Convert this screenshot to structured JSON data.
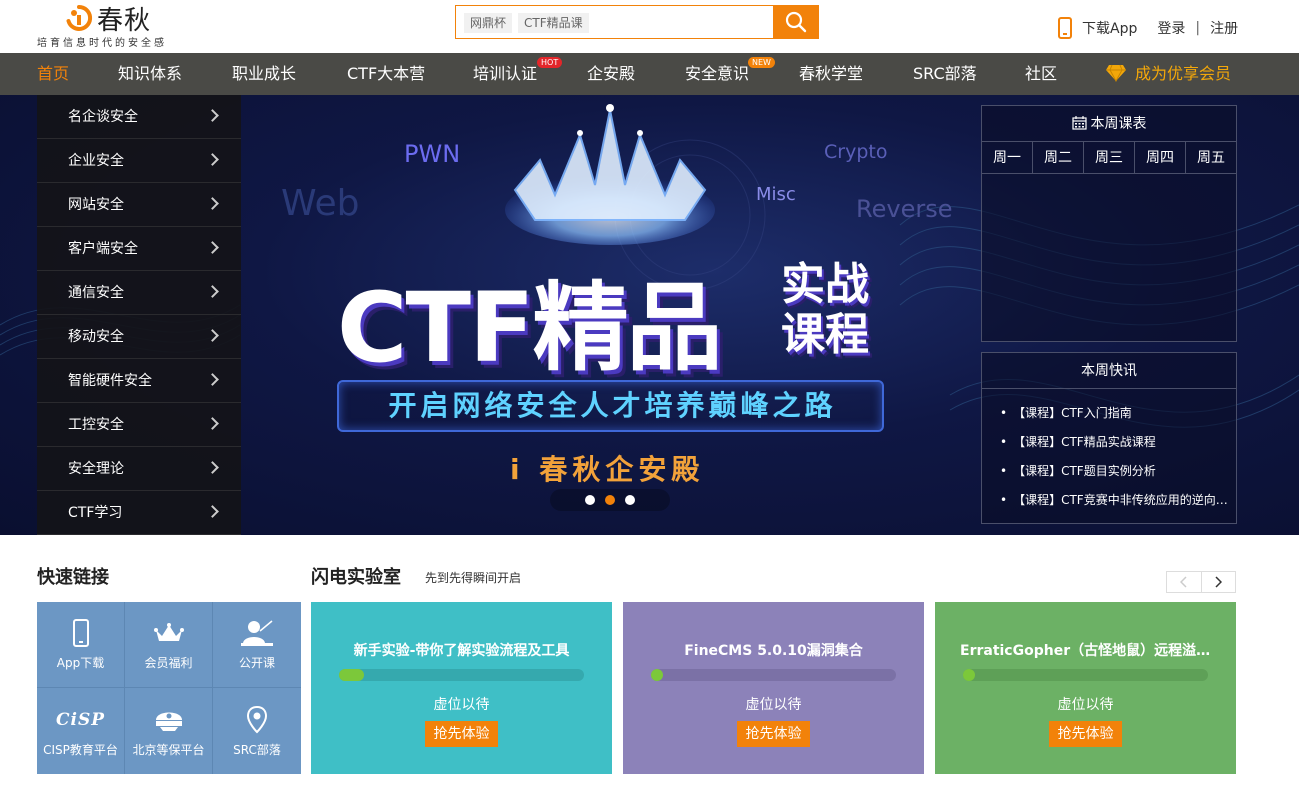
{
  "header": {
    "logo_text": "春秋",
    "slogan": "培育信息时代的安全感",
    "search_tags": [
      "网鼎杯",
      "CTF精品课"
    ],
    "download_app": "下载App",
    "login": "登录",
    "separator": "|",
    "register": "注册"
  },
  "nav": {
    "items": [
      "首页",
      "知识体系",
      "职业成长",
      "CTF大本营",
      "培训认证",
      "企安殿",
      "安全意识",
      "春秋学堂",
      "SRC部落",
      "社区"
    ],
    "badge_hot": "HOT",
    "badge_new": "NEW",
    "vip": "成为优享会员"
  },
  "side_menu": [
    "名企谈安全",
    "企业安全",
    "网站安全",
    "客户端安全",
    "通信安全",
    "移动安全",
    "智能硬件安全",
    "工控安全",
    "安全理论",
    "CTF学习"
  ],
  "banner": {
    "kw_pwn": "PWN",
    "kw_web": "Web",
    "kw_crypto": "Crypto",
    "kw_misc": "Misc",
    "kw_reverse": "Reverse",
    "title": "CTF精品",
    "side_line1": "实战",
    "side_line2": "课程",
    "slogan": "开启网络安全人才培养巅峰之路",
    "brand": "i 春秋企安殿",
    "active_dot": 1
  },
  "schedule": {
    "title": "本周课表",
    "days": [
      "周一",
      "周二",
      "周三",
      "周四",
      "周五"
    ]
  },
  "news": {
    "title": "本周快讯",
    "items": [
      "【课程】CTF入门指南",
      "【课程】CTF精品实战课程",
      "【课程】CTF题目实例分析",
      "【课程】CTF竞赛中非传统应用的逆向分析"
    ]
  },
  "quick_links": {
    "title": "快速链接",
    "items": [
      {
        "label": "App下载",
        "icon": "phone-icon"
      },
      {
        "label": "会员福利",
        "icon": "crown-icon"
      },
      {
        "label": "公开课",
        "icon": "lecturer-icon"
      },
      {
        "label": "CISP教育平台",
        "icon": "cisp-icon",
        "icon_text": "CiSP"
      },
      {
        "label": "北京等保平台",
        "icon": "police-cap-icon"
      },
      {
        "label": "SRC部落",
        "icon": "location-pin-icon"
      }
    ]
  },
  "labs": {
    "title": "闪电实验室",
    "subtitle": "先到先得瞬间开启",
    "cards": [
      {
        "title": "新手实验-带你了解实验流程及工具",
        "status": "虚位以待",
        "button": "抢先体验",
        "color": "#3fbfc6",
        "track": "#35a9ae",
        "progress": 0.1
      },
      {
        "title": "FineCMS 5.0.10漏洞集合",
        "status": "虚位以待",
        "button": "抢先体验",
        "color": "#8c82b9",
        "track": "#7b71a6",
        "progress": 0.05
      },
      {
        "title": "ErraticGopher（古怪地鼠）远程溢出漏洞",
        "status": "虚位以待",
        "button": "抢先体验",
        "color": "#6cb165",
        "track": "#5ea057",
        "progress": 0.0
      }
    ]
  },
  "colors": {
    "accent": "#f2820a",
    "nav_bg": "#4a4a46"
  }
}
